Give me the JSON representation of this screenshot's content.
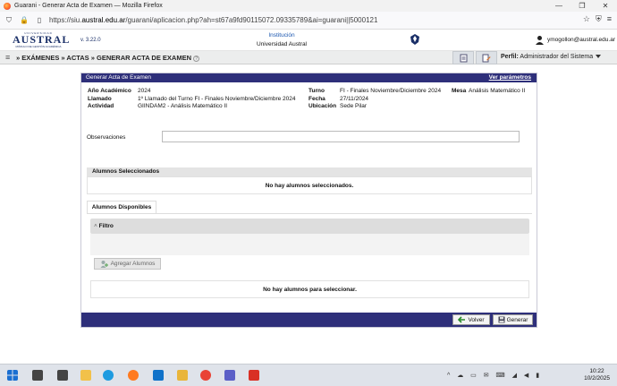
{
  "browser": {
    "title": "Guarani - Generar Acta de Examen — Mozilla Firefox",
    "url_prefix": "https://siu.",
    "url_domain": "austral.edu.ar",
    "url_suffix": "/guarani/aplicacion.php?ah=st67a9fd90115072.09335789&ai=guarani||5000121"
  },
  "app": {
    "logo_top": "UNIVERSIDAD",
    "logo_main": "AUSTRAL",
    "logo_sub": "MÓDULO DE GESTIÓN ACADÉMICA",
    "version": "v. 3.22.0",
    "institution_label": "Institución",
    "institution_name": "Universidad Austral",
    "user_email": "ymogollon@austral.edu.ar"
  },
  "menu": {
    "breadcrumb": "» EXÁMENES » ACTAS » GENERAR ACTA DE EXAMEN",
    "perfil_label": "Perfil:",
    "perfil_value": "Administrador del Sistema"
  },
  "panel": {
    "title": "Generar Acta de Examen",
    "ver_parametros": "Ver parámetros",
    "fields": {
      "anio_label": "Año Académico",
      "anio_value": "2024",
      "llamado_label": "Llamado",
      "llamado_value": "1º Llamado del Turno FI - Finales Noviembre/Diciembre 2024",
      "actividad_label": "Actividad",
      "actividad_value": "GIINDAM2 - Análisis Matemático II",
      "turno_label": "Turno",
      "turno_value": "FI - Finales Noviembre/Diciembre 2024",
      "fecha_label": "Fecha",
      "fecha_value": "27/11/2024",
      "ubicacion_label": "Ubicación",
      "ubicacion_value": "Sede Pilar",
      "mesa_label": "Mesa",
      "mesa_value": "Análisis Matemático II"
    },
    "observaciones_label": "Observaciones",
    "observaciones_value": "",
    "seleccionados_title": "Alumnos Seleccionados",
    "seleccionados_empty": "No hay alumnos seleccionados.",
    "disponibles_tab": "Alumnos Disponibles",
    "filtro_label": "Filtro",
    "agregar_label": "Agregar Alumnos",
    "disponibles_empty": "No hay alumnos para seleccionar.",
    "volver_label": "Volver",
    "generar_label": "Generar"
  },
  "taskbar": {
    "time": "10:22",
    "date": "10/2/2025"
  }
}
